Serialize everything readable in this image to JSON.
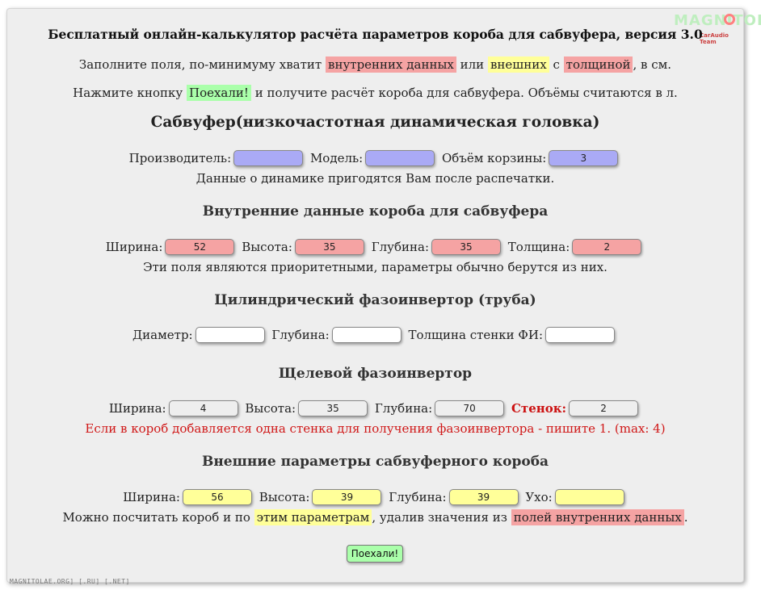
{
  "header": {
    "title": "Бесплатный онлайн-калькулятор расчёта параметров короба для сабвуфера, версия 3.0",
    "logo_text": "MAGNITOLA",
    "logo_sub": "CarAudio Team"
  },
  "intro": {
    "line1_a": "Заполните поля, по-минимуму хватит",
    "line1_internal": "внутренних данных",
    "line1_or": "или",
    "line1_external": "внешних",
    "line1_with": "с",
    "line1_thickness": "толщиной",
    "line1_end": ", в см.",
    "line2_a": "Нажмите кнопку",
    "line2_button": "Поехали!",
    "line2_b": "и получите расчёт короба для сабвуфера. Объёмы считаются в л."
  },
  "subwoofer": {
    "heading": "Сабвуфер(низкочастотная динамическая головка)",
    "manufacturer_label": "Производитель:",
    "manufacturer_value": "",
    "model_label": "Модель:",
    "model_value": "",
    "basket_label": "Объём корзины:",
    "basket_value": "3",
    "note": "Данные о динамике пригодятся Вам после распечатки."
  },
  "internal": {
    "heading": "Внутренние данные короба для сабвуфера",
    "width_label": "Ширина:",
    "width_value": "52",
    "height_label": "Высота:",
    "height_value": "35",
    "depth_label": "Глубина:",
    "depth_value": "35",
    "thickness_label": "Толщина:",
    "thickness_value": "2",
    "note": "Эти поля являются приоритетными, параметры обычно берутся из них."
  },
  "tube_port": {
    "heading": "Цилиндрический фазоинвертор (труба)",
    "diameter_label": "Диаметр:",
    "diameter_value": "",
    "depth_label": "Глубина:",
    "depth_value": "",
    "wall_label": "Толщина стенки ФИ:",
    "wall_value": ""
  },
  "slot_port": {
    "heading": "Щелевой фазоинвертор",
    "width_label": "Ширина:",
    "width_value": "4",
    "height_label": "Высота:",
    "height_value": "35",
    "depth_label": "Глубина:",
    "depth_value": "70",
    "walls_label": "Стенок:",
    "walls_value": "2",
    "note": "Если в короб добавляется одна стенка для получения фазоинвертора - пишите 1. (max: 4)"
  },
  "external": {
    "heading": "Внешние параметры сабвуферного короба",
    "width_label": "Ширина:",
    "width_value": "56",
    "height_label": "Высота:",
    "height_value": "39",
    "depth_label": "Глубина:",
    "depth_value": "39",
    "ear_label": "Ухо:",
    "ear_value": "",
    "note_a": "Можно посчитать короб и по",
    "note_these": "этим параметрам",
    "note_b": ", удалив значения из",
    "note_fields": "полей внутренних данных",
    "note_end": "."
  },
  "actions": {
    "go_label": "Поехали!"
  },
  "footer": {
    "text": "MAGNITOLAE.ORG] [.RU] [.NET]"
  }
}
